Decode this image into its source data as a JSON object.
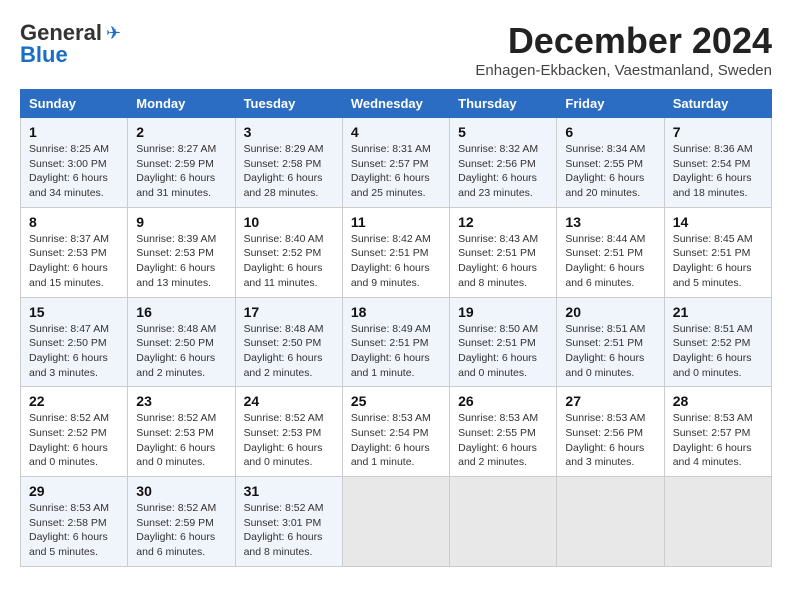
{
  "header": {
    "logo_general": "General",
    "logo_blue": "Blue",
    "title": "December 2024",
    "location": "Enhagen-Ekbacken, Vaestmanland, Sweden"
  },
  "days_of_week": [
    "Sunday",
    "Monday",
    "Tuesday",
    "Wednesday",
    "Thursday",
    "Friday",
    "Saturday"
  ],
  "weeks": [
    [
      {
        "day": "1",
        "info": "Sunrise: 8:25 AM\nSunset: 3:00 PM\nDaylight: 6 hours\nand 34 minutes."
      },
      {
        "day": "2",
        "info": "Sunrise: 8:27 AM\nSunset: 2:59 PM\nDaylight: 6 hours\nand 31 minutes."
      },
      {
        "day": "3",
        "info": "Sunrise: 8:29 AM\nSunset: 2:58 PM\nDaylight: 6 hours\nand 28 minutes."
      },
      {
        "day": "4",
        "info": "Sunrise: 8:31 AM\nSunset: 2:57 PM\nDaylight: 6 hours\nand 25 minutes."
      },
      {
        "day": "5",
        "info": "Sunrise: 8:32 AM\nSunset: 2:56 PM\nDaylight: 6 hours\nand 23 minutes."
      },
      {
        "day": "6",
        "info": "Sunrise: 8:34 AM\nSunset: 2:55 PM\nDaylight: 6 hours\nand 20 minutes."
      },
      {
        "day": "7",
        "info": "Sunrise: 8:36 AM\nSunset: 2:54 PM\nDaylight: 6 hours\nand 18 minutes."
      }
    ],
    [
      {
        "day": "8",
        "info": "Sunrise: 8:37 AM\nSunset: 2:53 PM\nDaylight: 6 hours\nand 15 minutes."
      },
      {
        "day": "9",
        "info": "Sunrise: 8:39 AM\nSunset: 2:53 PM\nDaylight: 6 hours\nand 13 minutes."
      },
      {
        "day": "10",
        "info": "Sunrise: 8:40 AM\nSunset: 2:52 PM\nDaylight: 6 hours\nand 11 minutes."
      },
      {
        "day": "11",
        "info": "Sunrise: 8:42 AM\nSunset: 2:51 PM\nDaylight: 6 hours\nand 9 minutes."
      },
      {
        "day": "12",
        "info": "Sunrise: 8:43 AM\nSunset: 2:51 PM\nDaylight: 6 hours\nand 8 minutes."
      },
      {
        "day": "13",
        "info": "Sunrise: 8:44 AM\nSunset: 2:51 PM\nDaylight: 6 hours\nand 6 minutes."
      },
      {
        "day": "14",
        "info": "Sunrise: 8:45 AM\nSunset: 2:51 PM\nDaylight: 6 hours\nand 5 minutes."
      }
    ],
    [
      {
        "day": "15",
        "info": "Sunrise: 8:47 AM\nSunset: 2:50 PM\nDaylight: 6 hours\nand 3 minutes."
      },
      {
        "day": "16",
        "info": "Sunrise: 8:48 AM\nSunset: 2:50 PM\nDaylight: 6 hours\nand 2 minutes."
      },
      {
        "day": "17",
        "info": "Sunrise: 8:48 AM\nSunset: 2:50 PM\nDaylight: 6 hours\nand 2 minutes."
      },
      {
        "day": "18",
        "info": "Sunrise: 8:49 AM\nSunset: 2:51 PM\nDaylight: 6 hours\nand 1 minute."
      },
      {
        "day": "19",
        "info": "Sunrise: 8:50 AM\nSunset: 2:51 PM\nDaylight: 6 hours\nand 0 minutes."
      },
      {
        "day": "20",
        "info": "Sunrise: 8:51 AM\nSunset: 2:51 PM\nDaylight: 6 hours\nand 0 minutes."
      },
      {
        "day": "21",
        "info": "Sunrise: 8:51 AM\nSunset: 2:52 PM\nDaylight: 6 hours\nand 0 minutes."
      }
    ],
    [
      {
        "day": "22",
        "info": "Sunrise: 8:52 AM\nSunset: 2:52 PM\nDaylight: 6 hours\nand 0 minutes."
      },
      {
        "day": "23",
        "info": "Sunrise: 8:52 AM\nSunset: 2:53 PM\nDaylight: 6 hours\nand 0 minutes."
      },
      {
        "day": "24",
        "info": "Sunrise: 8:52 AM\nSunset: 2:53 PM\nDaylight: 6 hours\nand 0 minutes."
      },
      {
        "day": "25",
        "info": "Sunrise: 8:53 AM\nSunset: 2:54 PM\nDaylight: 6 hours\nand 1 minute."
      },
      {
        "day": "26",
        "info": "Sunrise: 8:53 AM\nSunset: 2:55 PM\nDaylight: 6 hours\nand 2 minutes."
      },
      {
        "day": "27",
        "info": "Sunrise: 8:53 AM\nSunset: 2:56 PM\nDaylight: 6 hours\nand 3 minutes."
      },
      {
        "day": "28",
        "info": "Sunrise: 8:53 AM\nSunset: 2:57 PM\nDaylight: 6 hours\nand 4 minutes."
      }
    ],
    [
      {
        "day": "29",
        "info": "Sunrise: 8:53 AM\nSunset: 2:58 PM\nDaylight: 6 hours\nand 5 minutes."
      },
      {
        "day": "30",
        "info": "Sunrise: 8:52 AM\nSunset: 2:59 PM\nDaylight: 6 hours\nand 6 minutes."
      },
      {
        "day": "31",
        "info": "Sunrise: 8:52 AM\nSunset: 3:01 PM\nDaylight: 6 hours\nand 8 minutes."
      },
      {
        "day": "",
        "info": ""
      },
      {
        "day": "",
        "info": ""
      },
      {
        "day": "",
        "info": ""
      },
      {
        "day": "",
        "info": ""
      }
    ]
  ]
}
